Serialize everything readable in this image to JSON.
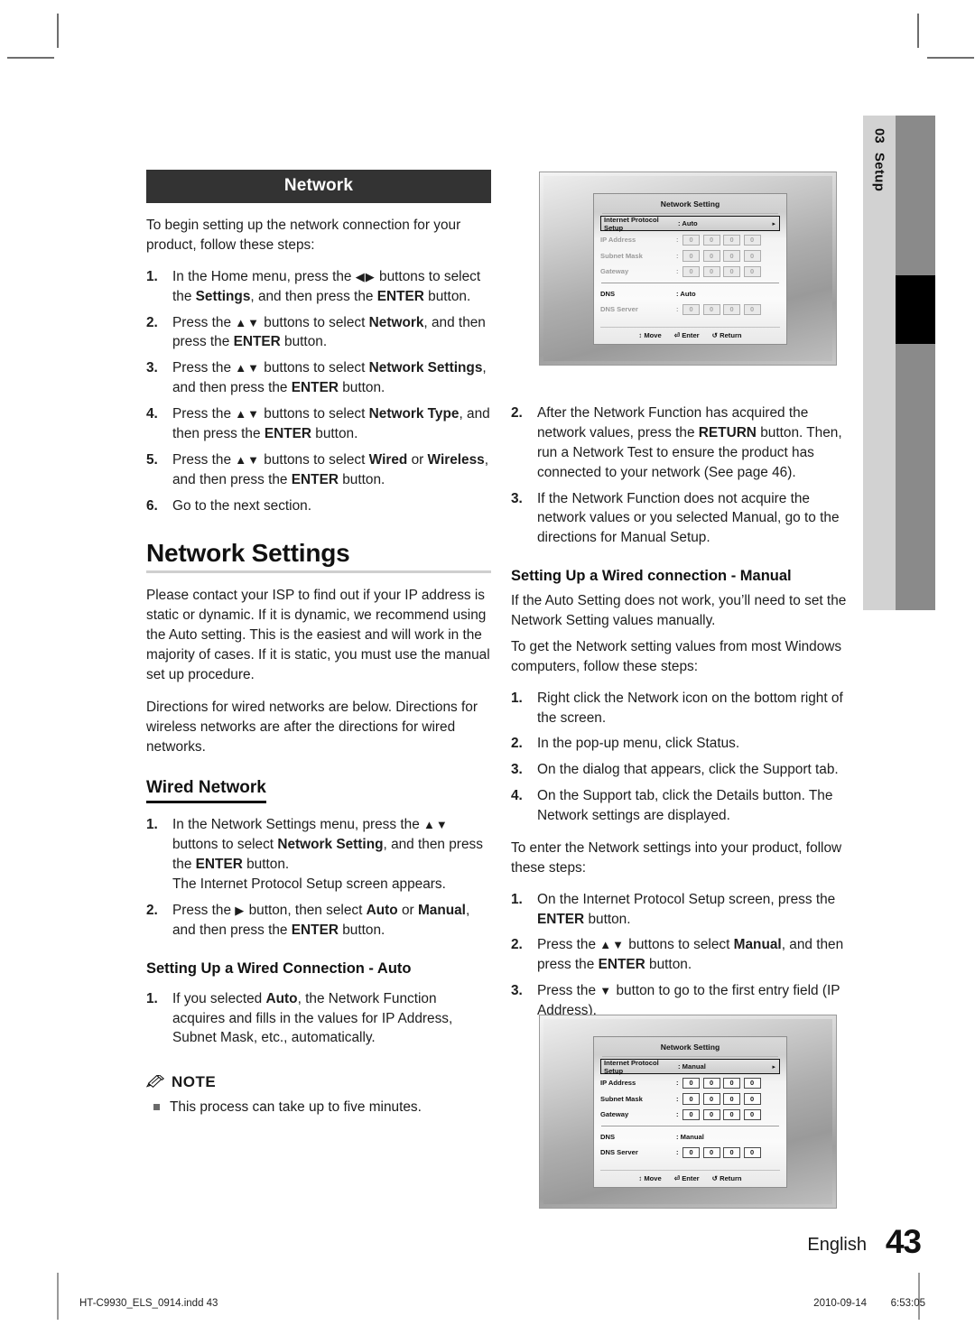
{
  "page": {
    "language": "English",
    "number": "43",
    "chapter_num": "03",
    "chapter_label": "Setup"
  },
  "footer": {
    "file": "HT-C9930_ELS_0914.indd  43",
    "date": "2010-09-14",
    "time": "6:53:05"
  },
  "left_column": {
    "section_bar": "Network",
    "intro": "To begin setting up the network connection for your product, follow these steps:",
    "steps": [
      {
        "n": "1.",
        "html": "In the Home menu, press the <span class=\"arrows\">◀▶</span> buttons to select the <span class=\"b\">Settings</span>, and then press the <span class=\"b\">ENTER</span> button."
      },
      {
        "n": "2.",
        "html": "Press the <span class=\"arrows\">▲▼</span> buttons to select <span class=\"b\">Network</span>, and then press the <span class=\"b\">ENTER</span> button."
      },
      {
        "n": "3.",
        "html": "Press the <span class=\"arrows\">▲▼</span> buttons to select <span class=\"b\">Network Settings</span>, and then press the <span class=\"b\">ENTER</span> button."
      },
      {
        "n": "4.",
        "html": "Press the <span class=\"arrows\">▲▼</span> buttons to select <span class=\"b\">Network Type</span>, and then press the <span class=\"b\">ENTER</span> button."
      },
      {
        "n": "5.",
        "html": "Press the <span class=\"arrows\">▲▼</span> buttons to select <span class=\"b\">Wired</span> or <span class=\"b\">Wireless</span>, and then press the <span class=\"b\">ENTER</span> button."
      },
      {
        "n": "6.",
        "html": "Go to the next section."
      }
    ],
    "heading": "Network Settings",
    "para1": "Please contact your ISP to find out if your IP address is static or dynamic. If it is dynamic, we recommend using the Auto setting. This is the easiest and will work in the majority of cases. If it is static, you must use the manual set up procedure.",
    "para2": "Directions for wired networks are below. Directions for wireless networks are after the directions for wired networks.",
    "sub_heading": "Wired Network",
    "steps2": [
      {
        "n": "1.",
        "html": "In the Network Settings menu, press the <span class=\"arrows\">▲▼</span> buttons to select <span class=\"b\">Network Setting</span>, and then press the <span class=\"b\">ENTER</span> button.<br>The Internet Protocol Setup screen appears."
      },
      {
        "n": "2.",
        "html": "Press the <span class=\"arrows\">▶</span> button, then select <span class=\"b\">Auto</span> or <span class=\"b\">Manual</span>, and then press the <span class=\"b\">ENTER</span> button."
      }
    ],
    "bold_heading": "Setting Up a Wired Connection - Auto",
    "steps3": [
      {
        "n": "1.",
        "html": "If you selected <span class=\"b\">Auto</span>, the Network Function acquires and fills in the values for IP Address, Subnet Mask, etc., automatically."
      }
    ],
    "note_title": "NOTE",
    "note_items": [
      "This process can take up to five minutes."
    ]
  },
  "right_column": {
    "steps_top": [
      {
        "n": "2.",
        "html": "After the Network Function has acquired the network values, press the <span class=\"b\">RETURN</span> button. Then, run a Network Test to ensure the product has connected to your network (See page 46)."
      },
      {
        "n": "3.",
        "html": "If the Network Function does not acquire the network values or you selected Manual, go to the directions for Manual Setup."
      }
    ],
    "bold_heading": "Setting Up a Wired connection - Manual",
    "para1": "If the Auto Setting does not work, you’ll need to set the Network Setting values manually.",
    "para2": "To get the Network setting values from most Windows computers, follow these steps:",
    "steps_mid": [
      {
        "n": "1.",
        "html": "Right click the Network icon on the bottom right of the screen."
      },
      {
        "n": "2.",
        "html": "In the pop-up menu, click Status."
      },
      {
        "n": "3.",
        "html": "On the dialog that appears, click the Support tab."
      },
      {
        "n": "4.",
        "html": "On the Support tab, click the Details button. The Network settings are displayed."
      }
    ],
    "para3": "To enter the Network settings into your product, follow these steps:",
    "steps_bottom": [
      {
        "n": "1.",
        "html": "On the Internet Protocol Setup screen, press the <span class=\"b\">ENTER</span> button."
      },
      {
        "n": "2.",
        "html": "Press the <span class=\"arrows\">▲▼</span> buttons to select <span class=\"b\">Manual</span>, and then press the <span class=\"b\">ENTER</span> button."
      },
      {
        "n": "3.",
        "html": "Press the <span class=\"arrows\">▼</span> button to go to the first entry field (IP Address)."
      }
    ]
  },
  "screenshot_auto": {
    "title": "Network Setting",
    "selected_row": {
      "label": "Internet Protocol Setup",
      "value": ": Auto"
    },
    "rows": [
      {
        "label": "IP Address",
        "boxes": [
          "0",
          "0",
          "0",
          "0"
        ],
        "dim": true
      },
      {
        "label": "Subnet Mask",
        "boxes": [
          "0",
          "0",
          "0",
          "0"
        ],
        "dim": true
      },
      {
        "label": "Gateway",
        "boxes": [
          "0",
          "0",
          "0",
          "0"
        ],
        "dim": true
      }
    ],
    "dns_row": {
      "label": "DNS",
      "value": ": Auto"
    },
    "dns_server": {
      "label": "DNS Server",
      "boxes": [
        "0",
        "0",
        "0",
        "0"
      ],
      "dim": true
    },
    "footer": [
      "↕ Move",
      "⏎ Enter",
      "↺ Return"
    ]
  },
  "screenshot_manual": {
    "title": "Network Setting",
    "selected_row": {
      "label": "Internet Protocol Setup",
      "value": ": Manual"
    },
    "rows": [
      {
        "label": "IP Address",
        "boxes": [
          "0",
          "0",
          "0",
          "0"
        ],
        "dim": false
      },
      {
        "label": "Subnet Mask",
        "boxes": [
          "0",
          "0",
          "0",
          "0"
        ],
        "dim": false
      },
      {
        "label": "Gateway",
        "boxes": [
          "0",
          "0",
          "0",
          "0"
        ],
        "dim": false
      }
    ],
    "dns_row": {
      "label": "DNS",
      "value": ": Manual"
    },
    "dns_server": {
      "label": "DNS Server",
      "boxes": [
        "0",
        "0",
        "0",
        "0"
      ],
      "dim": false
    },
    "footer": [
      "↕ Move",
      "⏎ Enter",
      "↺ Return"
    ]
  }
}
